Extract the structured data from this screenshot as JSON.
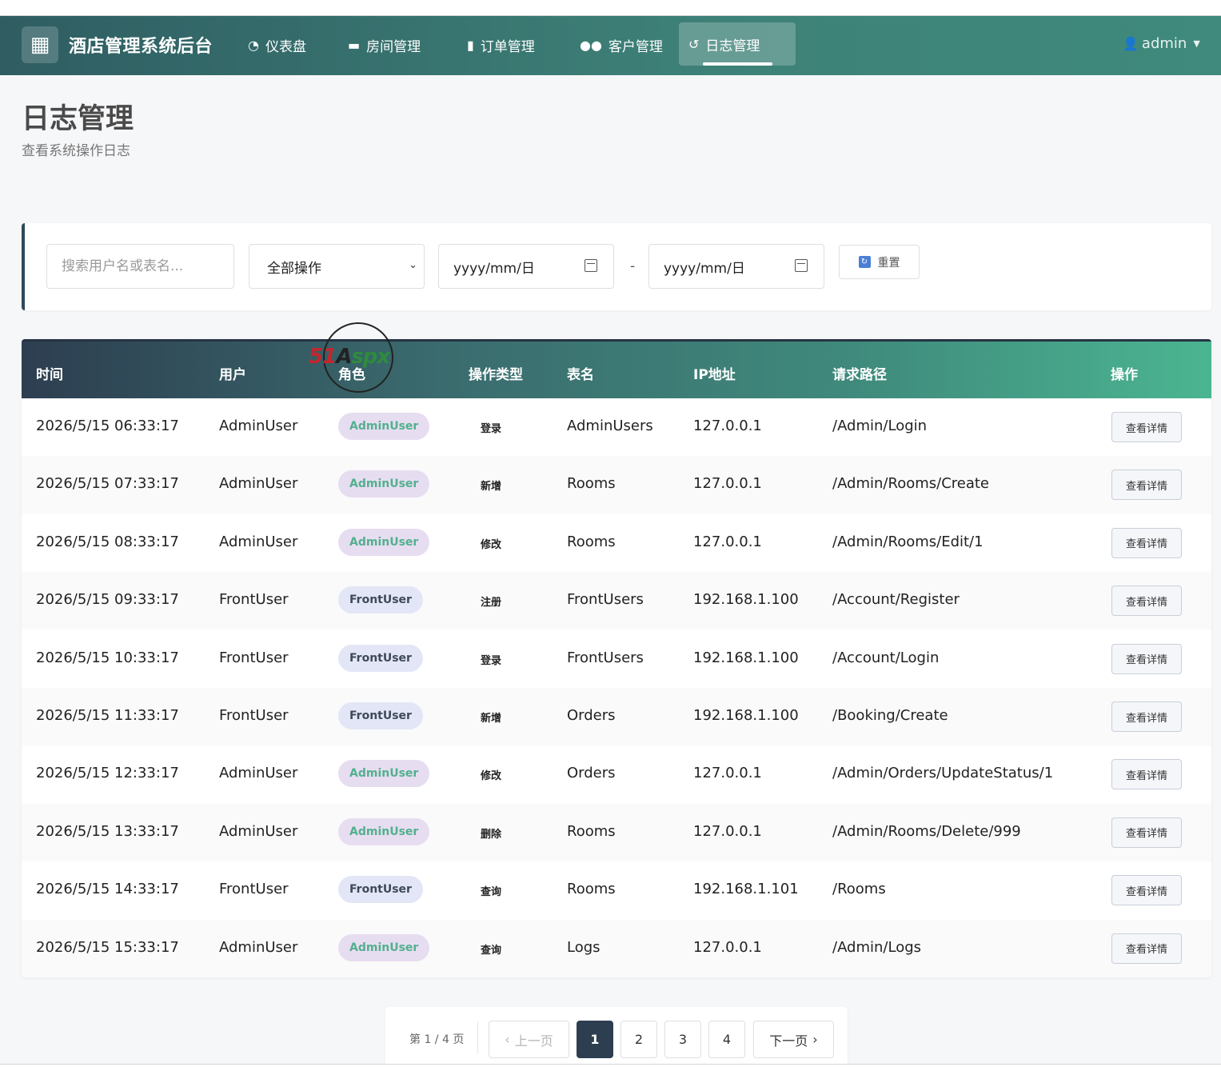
{
  "navbar": {
    "brand": "酒店管理系统后台",
    "items": [
      {
        "label": "仪表盘",
        "icon": "tachometer-icon"
      },
      {
        "label": "房间管理",
        "icon": "bed-icon"
      },
      {
        "label": "订单管理",
        "icon": "clipboard-icon"
      },
      {
        "label": "客户管理",
        "icon": "users-icon"
      },
      {
        "label": "日志管理",
        "icon": "history-icon",
        "active": true
      }
    ],
    "user": "admin"
  },
  "header": {
    "title": "日志管理",
    "subtitle": "查看系统操作日志"
  },
  "filters": {
    "search_placeholder": "搜索用户名或表名...",
    "operation_selected": "全部操作",
    "date_from_placeholder": "yyyy/mm/日",
    "date_separator": "-",
    "date_to_placeholder": "yyyy/mm/日",
    "reset_label": "重置"
  },
  "table": {
    "columns": [
      "时间",
      "用户",
      "角色",
      "操作类型",
      "表名",
      "IP地址",
      "请求路径",
      "操作"
    ],
    "detail_label": "查看详情",
    "rows": [
      {
        "time": "2026/5/15 06:33:17",
        "user": "AdminUser",
        "role": "AdminUser",
        "op": "登录",
        "table": "AdminUsers",
        "ip": "127.0.0.1",
        "path": "/Admin/Login"
      },
      {
        "time": "2026/5/15 07:33:17",
        "user": "AdminUser",
        "role": "AdminUser",
        "op": "新增",
        "table": "Rooms",
        "ip": "127.0.0.1",
        "path": "/Admin/Rooms/Create"
      },
      {
        "time": "2026/5/15 08:33:17",
        "user": "AdminUser",
        "role": "AdminUser",
        "op": "修改",
        "table": "Rooms",
        "ip": "127.0.0.1",
        "path": "/Admin/Rooms/Edit/1"
      },
      {
        "time": "2026/5/15 09:33:17",
        "user": "FrontUser",
        "role": "FrontUser",
        "op": "注册",
        "table": "FrontUsers",
        "ip": "192.168.1.100",
        "path": "/Account/Register"
      },
      {
        "time": "2026/5/15 10:33:17",
        "user": "FrontUser",
        "role": "FrontUser",
        "op": "登录",
        "table": "FrontUsers",
        "ip": "192.168.1.100",
        "path": "/Account/Login"
      },
      {
        "time": "2026/5/15 11:33:17",
        "user": "FrontUser",
        "role": "FrontUser",
        "op": "新增",
        "table": "Orders",
        "ip": "192.168.1.100",
        "path": "/Booking/Create"
      },
      {
        "time": "2026/5/15 12:33:17",
        "user": "AdminUser",
        "role": "AdminUser",
        "op": "修改",
        "table": "Orders",
        "ip": "127.0.0.1",
        "path": "/Admin/Orders/UpdateStatus/1"
      },
      {
        "time": "2026/5/15 13:33:17",
        "user": "AdminUser",
        "role": "AdminUser",
        "op": "删除",
        "table": "Rooms",
        "ip": "127.0.0.1",
        "path": "/Admin/Rooms/Delete/999"
      },
      {
        "time": "2026/5/15 14:33:17",
        "user": "FrontUser",
        "role": "FrontUser",
        "op": "查询",
        "table": "Rooms",
        "ip": "192.168.1.101",
        "path": "/Rooms"
      },
      {
        "time": "2026/5/15 15:33:17",
        "user": "AdminUser",
        "role": "AdminUser",
        "op": "查询",
        "table": "Logs",
        "ip": "127.0.0.1",
        "path": "/Admin/Logs"
      }
    ]
  },
  "pagination": {
    "info": "第 1 / 4 页",
    "prev": "上一页",
    "next": "下一页",
    "pages": [
      "1",
      "2",
      "3",
      "4"
    ],
    "current": 1
  },
  "watermark": {
    "text_a": "51",
    "text_b": "A",
    "text_c": "spx"
  },
  "colors": {
    "nav_start": "#2f5d62",
    "nav_end": "#3f8a7c",
    "admin_badge_bg": "#e7ddf1",
    "admin_badge_text": "#52b08e",
    "front_badge_bg": "#e3e6f6",
    "front_badge_text": "#3e4a5a",
    "active_page": "#2d3e50"
  }
}
